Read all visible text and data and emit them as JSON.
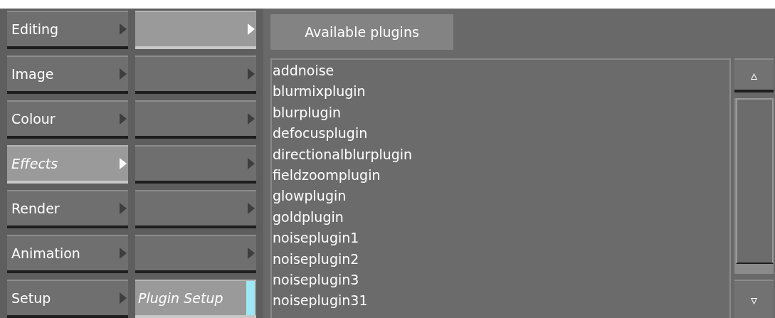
{
  "categories": [
    {
      "label": "Editing",
      "selected": false
    },
    {
      "label": "Image",
      "selected": false
    },
    {
      "label": "Colour",
      "selected": false
    },
    {
      "label": "Effects",
      "selected": true
    },
    {
      "label": "Render",
      "selected": false
    },
    {
      "label": "Animation",
      "selected": false
    },
    {
      "label": "Setup",
      "selected": false
    }
  ],
  "submenu": [
    {
      "kind": "arrow",
      "selected": true
    },
    {
      "kind": "arrow",
      "selected": false
    },
    {
      "kind": "arrow",
      "selected": false
    },
    {
      "kind": "arrow",
      "selected": false
    },
    {
      "kind": "arrow",
      "selected": false
    },
    {
      "kind": "arrow",
      "selected": false
    },
    {
      "kind": "label",
      "label": "Plugin Setup",
      "selected": true
    }
  ],
  "plugins": {
    "title": "Available plugins",
    "items": [
      "addnoise",
      "blurmixplugin",
      "blurplugin",
      "defocusplugin",
      "directionalblurplugin",
      "fieldzoomplugin",
      "glowplugin",
      "goldplugin",
      "noiseplugin1",
      "noiseplugin2",
      "noiseplugin3",
      "noiseplugin31"
    ]
  },
  "scrollbar": {
    "up": "▵",
    "down": "▿"
  }
}
